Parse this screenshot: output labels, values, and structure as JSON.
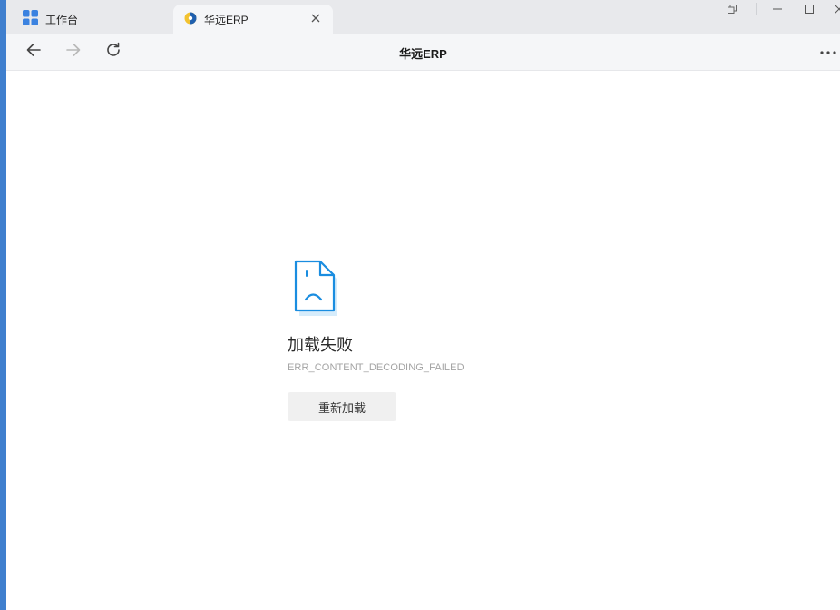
{
  "tabs": [
    {
      "label": "工作台",
      "icon": "apps-grid-icon",
      "active": false
    },
    {
      "label": "华远ERP",
      "icon": "huayuan-logo-icon",
      "active": true
    }
  ],
  "window_controls": [
    "restore-popout-icon",
    "minimize-icon",
    "maximize-icon",
    "close-icon"
  ],
  "nav": {
    "title": "华远ERP",
    "back_icon": "arrow-left-icon",
    "forward_icon": "arrow-right-icon",
    "reload_icon": "reload-icon",
    "more_icon": "more-horizontal-icon"
  },
  "error": {
    "icon": "sad-document-icon",
    "title": "加载失败",
    "code": "ERR_CONTENT_DECODING_FAILED",
    "reload_button": "重新加载"
  },
  "colors": {
    "accent": "#1a8de0",
    "left_edge": "#3f7fce",
    "tabbar_bg": "#e8e9ec",
    "navbar_bg": "#f5f6f8",
    "button_bg": "#f0f0f0"
  }
}
